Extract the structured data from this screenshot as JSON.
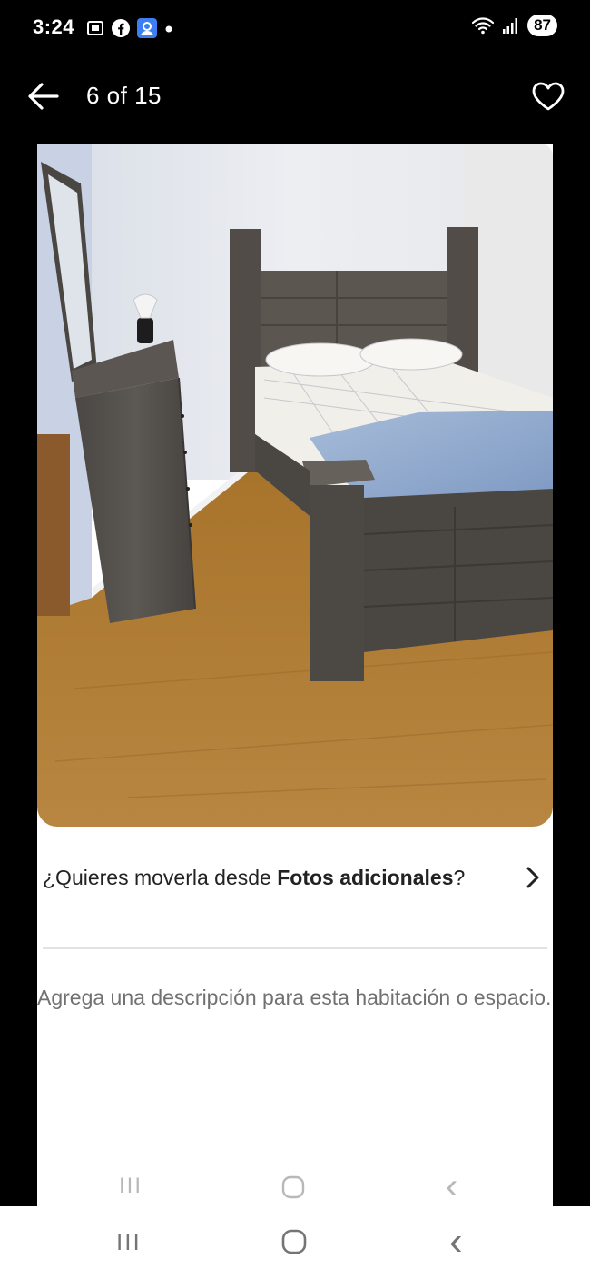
{
  "status_bar": {
    "time": "3:24",
    "battery": "87",
    "left_icons": [
      "screenshot-icon",
      "facebook-icon",
      "contact-app-icon",
      "notification-dot-icon"
    ],
    "right_icons": [
      "wifi-icon",
      "signal-icon",
      "battery-icon"
    ]
  },
  "header": {
    "counter": "6 of 15",
    "back_icon": "arrow-left-icon",
    "favorite_icon": "heart-outline-icon"
  },
  "photo": {
    "subject": "bedroom-photo"
  },
  "move_prompt": {
    "text_before": "¿Quieres moverla desde ",
    "bold_text": "Fotos adicionales",
    "text_after": "?"
  },
  "description": {
    "placeholder": "Agrega una descripción para esta habitación o espacio."
  },
  "inner_nav": {
    "recent": "III",
    "back": "‹"
  },
  "system_nav": {
    "recent": "III",
    "back": "‹"
  },
  "colors": {
    "background": "#000000",
    "card": "#ffffff",
    "text_primary": "#222222",
    "text_secondary": "#717171"
  }
}
